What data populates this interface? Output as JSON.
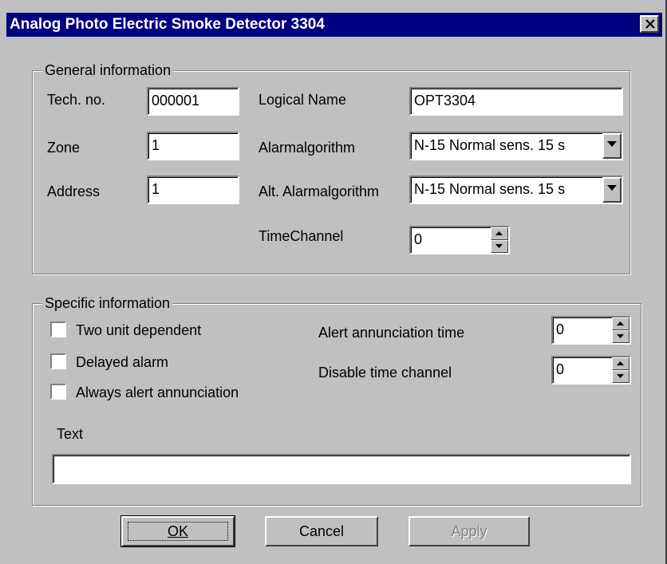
{
  "window": {
    "title": "Analog Photo Electric Smoke Detector 3304",
    "close_icon": "close-icon"
  },
  "general": {
    "legend": "General information",
    "tech_no_label": "Tech. no.",
    "tech_no_value": "000001",
    "zone_label": "Zone",
    "zone_value": "1",
    "address_label": "Address",
    "address_value": "1",
    "logical_name_label": "Logical Name",
    "logical_name_value": "OPT3304",
    "alarmalgorithm_label": "Alarmalgorithm",
    "alarmalgorithm_value": "N-15 Normal sens. 15 s",
    "alt_alarmalgorithm_label": "Alt. Alarmalgorithm",
    "alt_alarmalgorithm_value": "N-15 Normal sens. 15 s",
    "timechannel_label": "TimeChannel",
    "timechannel_value": "0"
  },
  "specific": {
    "legend": "Specific information",
    "two_unit_label": "Two unit dependent",
    "delayed_alarm_label": "Delayed alarm",
    "always_alert_label": "Always alert annunciation",
    "alert_time_label": "Alert annunciation time",
    "alert_time_value": "0",
    "disable_channel_label": "Disable time channel",
    "disable_channel_value": "0",
    "text_label": "Text",
    "text_value": ""
  },
  "buttons": {
    "ok": "OK",
    "cancel": "Cancel",
    "apply": "Apply"
  },
  "colors": {
    "titlebar": "#000080",
    "face": "#c0c0c0"
  }
}
